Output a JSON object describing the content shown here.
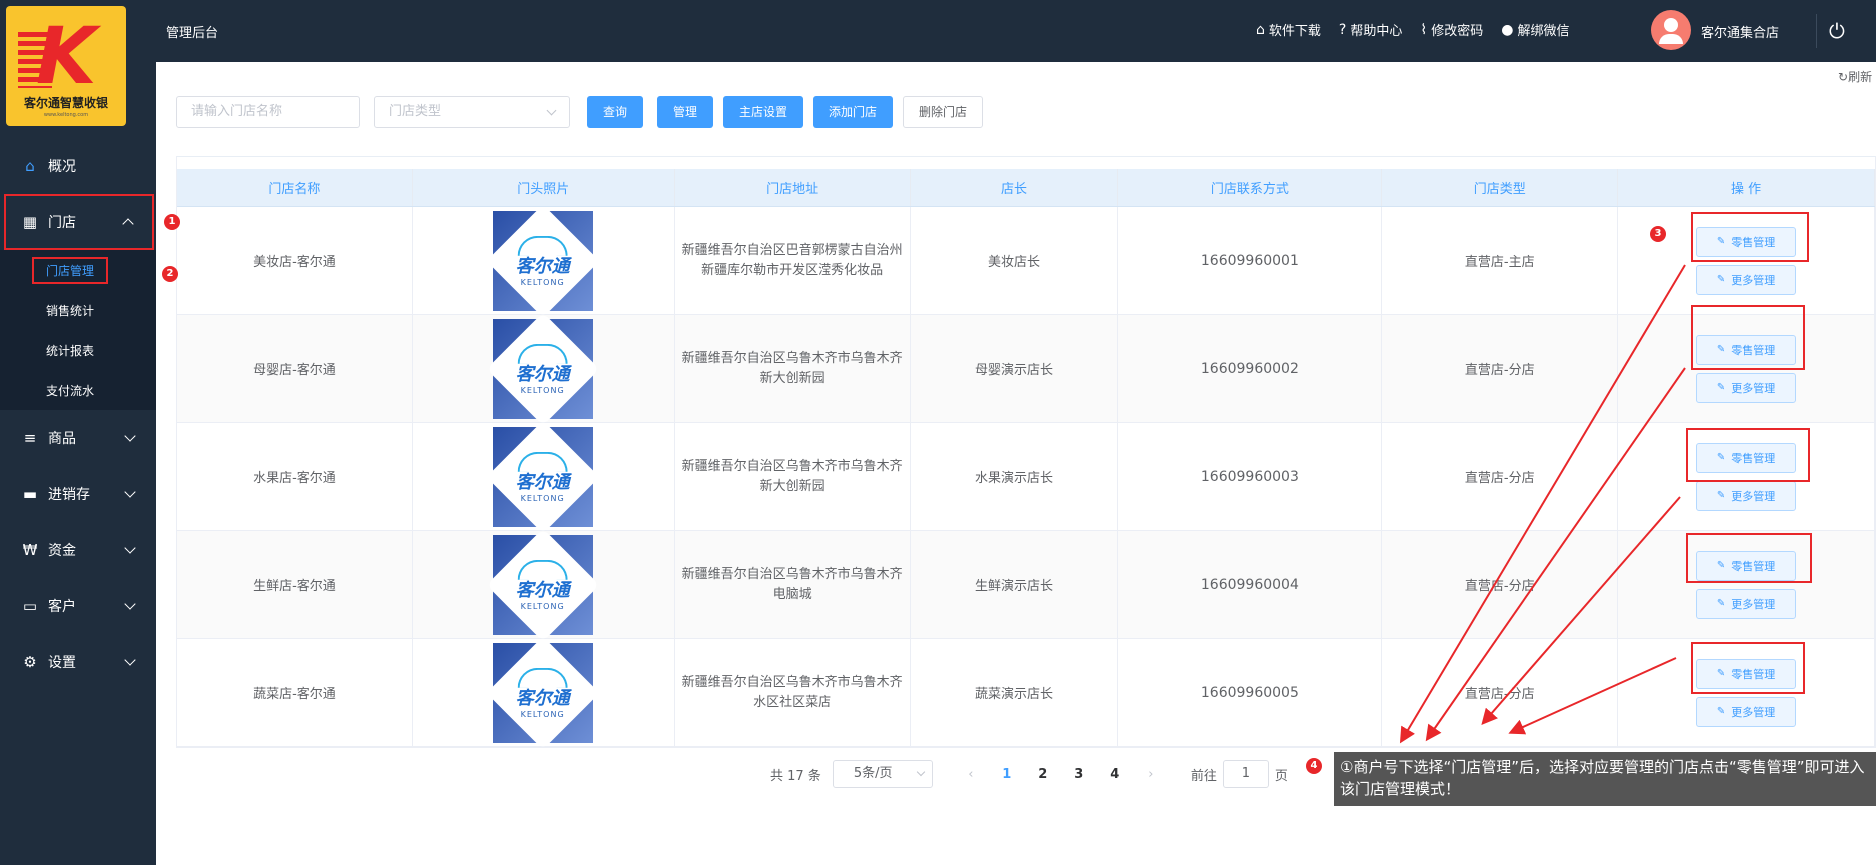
{
  "logo": {
    "name": "客尔通智慧收银",
    "sub": "www.keltong.com"
  },
  "header": {
    "title": "管理后台",
    "links": [
      {
        "icon": "store-icon",
        "glyph": "⌂",
        "label": "软件下载"
      },
      {
        "icon": "help-icon",
        "glyph": "?",
        "label": "帮助中心"
      },
      {
        "icon": "thermometer-icon",
        "glyph": "⌇",
        "label": "修改密码"
      },
      {
        "icon": "chat-icon",
        "glyph": "●",
        "label": "解绑微信"
      }
    ],
    "user": "客尔通集合店"
  },
  "sidebar": {
    "items": [
      {
        "label": "概况",
        "icon": "home-icon",
        "glyph": "⌂"
      },
      {
        "label": "门店",
        "icon": "building-icon",
        "glyph": "▦"
      },
      {
        "label": "商品",
        "icon": "list-icon",
        "glyph": "≡"
      },
      {
        "label": "进销存",
        "icon": "truck-icon",
        "glyph": "▬"
      },
      {
        "label": "资金",
        "icon": "won-icon",
        "glyph": "₩"
      },
      {
        "label": "客户",
        "icon": "id-card-icon",
        "glyph": "▭"
      },
      {
        "label": "设置",
        "icon": "gear-icon",
        "glyph": "⚙"
      }
    ],
    "sub_items": [
      "门店管理",
      "销售统计",
      "统计报表",
      "支付流水"
    ]
  },
  "toolbar": {
    "refresh": "刷新",
    "search_placeholder": "请输入门店名称",
    "type_placeholder": "门店类型",
    "query": "查询",
    "manage": "管理",
    "main_store_settings": "主店设置",
    "add_store": "添加门店",
    "delete_store": "删除门店"
  },
  "table": {
    "columns": [
      "门店名称",
      "门头照片",
      "门店地址",
      "店长",
      "门店联系方式",
      "门店类型",
      "操 作"
    ],
    "rows": [
      {
        "name": "美妆店-客尔通",
        "addr": "新疆维吾尔自治区巴音郭楞蒙古自治州新疆库尔勒市开发区滢秀化妆品",
        "manager": "美妆店长",
        "phone": "16609960001",
        "type": "直营店-主店"
      },
      {
        "name": "母婴店-客尔通",
        "addr": "新疆维吾尔自治区乌鲁木齐市乌鲁木齐新大创新园",
        "manager": "母婴演示店长",
        "phone": "16609960002",
        "type": "直营店-分店"
      },
      {
        "name": "水果店-客尔通",
        "addr": "新疆维吾尔自治区乌鲁木齐市乌鲁木齐新大创新园",
        "manager": "水果演示店长",
        "phone": "16609960003",
        "type": "直营店-分店"
      },
      {
        "name": "生鲜店-客尔通",
        "addr": "新疆维吾尔自治区乌鲁木齐市乌鲁木齐电脑城",
        "manager": "生鲜演示店长",
        "phone": "16609960004",
        "type": "直营店-分店"
      },
      {
        "name": "蔬菜店-客尔通",
        "addr": "新疆维吾尔自治区乌鲁木齐市乌鲁木齐水区社区菜店",
        "manager": "蔬菜演示店长",
        "phone": "16609960005",
        "type": "直营店-分店"
      }
    ],
    "photo_text": "客尔通",
    "photo_sub": "KELTONG",
    "op_retail": "零售管理",
    "op_more": "更多管理"
  },
  "pagination": {
    "total": "共 17 条",
    "page_size": "5条/页",
    "pages": [
      "1",
      "2",
      "3",
      "4"
    ],
    "goto_label": "前往",
    "goto_value": "1",
    "page_unit": "页"
  },
  "annotations": {
    "badges": [
      "1",
      "2",
      "3",
      "4"
    ],
    "note": "①商户号下选择“门店管理”后，选择对应要管理的门店点击“零售管理”即可进入该门店管理模式！"
  }
}
